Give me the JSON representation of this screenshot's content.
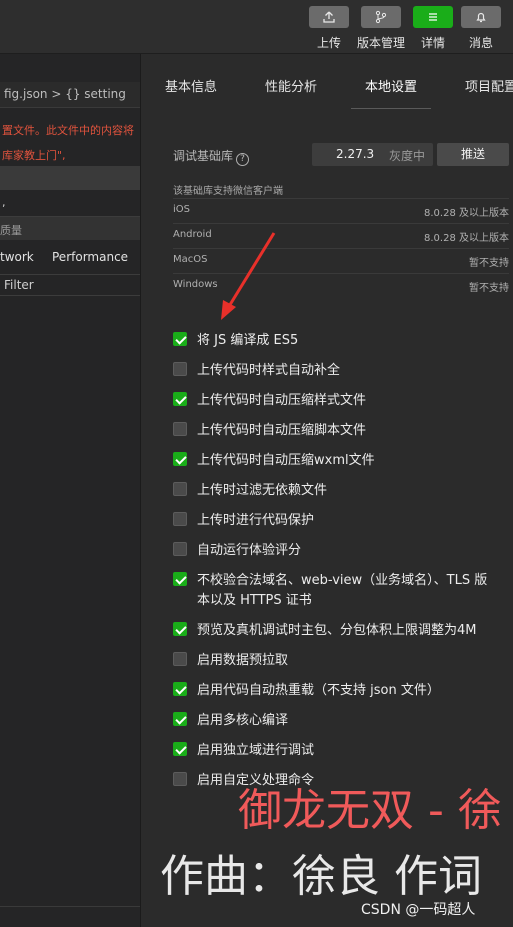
{
  "toolbar": {
    "buttons": [
      {
        "label": "上传",
        "icon": "upload-icon"
      },
      {
        "label": "版本管理",
        "icon": "branch-icon"
      },
      {
        "label": "详情",
        "icon": "menu-icon"
      },
      {
        "label": "消息",
        "icon": "bell-icon"
      }
    ]
  },
  "left": {
    "breadcrumb": "fig.json > {} setting",
    "code_line1": "置文件。此文件中的内容将",
    "code_line2": "库家教上门\",",
    "code_line3": ",",
    "debug_title": "质量",
    "tabs": [
      "twork",
      "Performance"
    ],
    "filter": "Filter"
  },
  "right": {
    "tabs": [
      "基本信息",
      "性能分析",
      "本地设置",
      "项目配置"
    ],
    "active_tab": "本地设置",
    "lib_label": "调试基础库",
    "help_glyph": "?",
    "lib_version": "2.27.3",
    "lib_channel": "灰度中",
    "push_label": "推送",
    "support_title": "该基础库支持微信客户端",
    "platforms": [
      {
        "name": "iOS",
        "value": "8.0.28 及以上版本"
      },
      {
        "name": "Android",
        "value": "8.0.28 及以上版本"
      },
      {
        "name": "MacOS",
        "value": "暂不支持"
      },
      {
        "name": "Windows",
        "value": "暂不支持"
      }
    ],
    "options": [
      {
        "label": "将 JS 编译成 ES5",
        "checked": true
      },
      {
        "label": "上传代码时样式自动补全",
        "checked": false
      },
      {
        "label": "上传代码时自动压缩样式文件",
        "checked": true
      },
      {
        "label": "上传代码时自动压缩脚本文件",
        "checked": false
      },
      {
        "label": "上传代码时自动压缩wxml文件",
        "checked": true
      },
      {
        "label": "上传时过滤无依赖文件",
        "checked": false
      },
      {
        "label": "上传时进行代码保护",
        "checked": false
      },
      {
        "label": "自动运行体验评分",
        "checked": false
      },
      {
        "label": "不校验合法域名、web-view（业务域名）、TLS 版本以及 HTTPS 证书",
        "checked": true
      },
      {
        "label": "预览及真机调试时主包、分包体积上限调整为4M",
        "checked": true
      },
      {
        "label": "启用数据预拉取",
        "checked": false
      },
      {
        "label": "启用代码自动热重载（不支持 json 文件）",
        "checked": true
      },
      {
        "label": "启用多核心编译",
        "checked": true
      },
      {
        "label": "启用独立域进行调试",
        "checked": true
      },
      {
        "label": "启用自定义处理命令",
        "checked": false
      }
    ]
  },
  "overlay": {
    "caption_red": "御龙无双 - 徐",
    "caption_white": "作曲：徐良 作词",
    "watermark": "CSDN @一码超人"
  },
  "colors": {
    "accent_green": "#1aad19",
    "arrow_red": "#e8302a"
  }
}
